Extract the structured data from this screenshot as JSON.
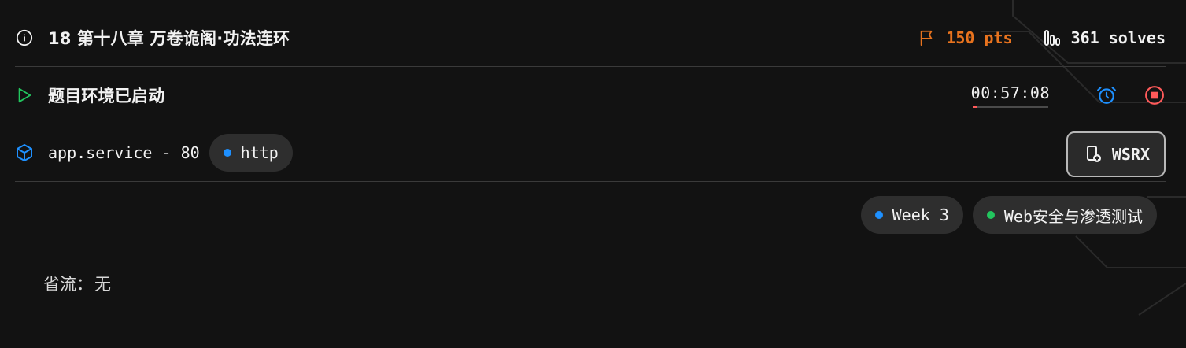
{
  "challenge": {
    "title": "18 第十八章 万卷诡阁·功法连环",
    "points": "150 pts",
    "solves": "361 solves"
  },
  "environment": {
    "status": "题目环境已启动",
    "timer": "00:57:08",
    "timer_remaining_fraction": 0.05
  },
  "service": {
    "name": "app.service - 80",
    "protocol": "http",
    "wsrx_label": "WSRX"
  },
  "tags": [
    {
      "label": "Week 3",
      "color": "#1e90ff"
    },
    {
      "label": "Web安全与渗透测试",
      "color": "#22c55e"
    }
  ],
  "description": {
    "label": "省流：",
    "value": "无"
  },
  "colors": {
    "accent_orange": "#e8731e",
    "accent_blue": "#1e90ff",
    "accent_green": "#22c55e",
    "danger_red": "#ff5a5a"
  },
  "icons": {
    "info": "info-icon",
    "flag": "flag-icon",
    "solves": "bar-chart-icon",
    "play": "play-icon",
    "alarm": "alarm-clock-icon",
    "stop": "stop-icon",
    "box": "box-icon",
    "wsrx": "copy-plus-icon"
  }
}
